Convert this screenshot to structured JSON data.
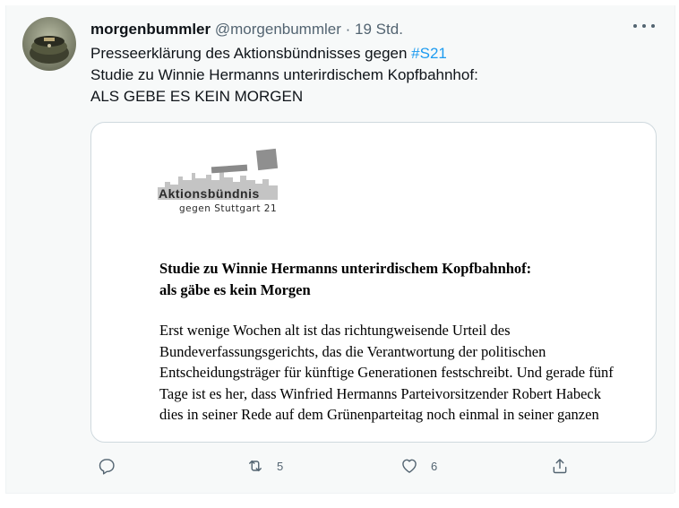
{
  "tweet": {
    "display_name": "morgenbummler",
    "handle": "@morgenbummler",
    "separator": "·",
    "time": "19 Std.",
    "text_line1_prefix": "Presseerklärung des Aktionsbündnisses gegen ",
    "hashtag": "#S21",
    "text_line2": "Studie zu Winnie Hermanns unterirdischem Kopfbahnhof:",
    "text_line3": "ALS GEBE ES KEIN MORGEN"
  },
  "card": {
    "logo_word": "Aktionsbündnis",
    "logo_sub": "gegen Stuttgart 21",
    "doc_heading_line1": "Studie zu Winnie Hermanns unterirdischem Kopfbahnhof:",
    "doc_heading_line2": "als gäbe es kein Morgen",
    "doc_body": "Erst wenige Wochen alt ist das richtungweisende Urteil des Bundeverfassungsgerichts, das die Verantwortung der politischen Entscheidungsträger für künftige Generationen festschreibt. Und gerade fünf Tage ist es her, dass Winfried Hermanns Parteivorsitzender Robert Habeck dies in seiner Rede auf dem Grünenparteitag noch einmal in seiner ganzen"
  },
  "actions": {
    "reply_icon": "reply-icon",
    "retweet_icon": "retweet-icon",
    "retweet_count": "5",
    "like_icon": "like-icon",
    "like_count": "6",
    "share_icon": "share-icon"
  },
  "colors": {
    "accent": "#1d9bf0",
    "secondary_text": "#536471",
    "tweet_background": "#f7f9f9"
  }
}
